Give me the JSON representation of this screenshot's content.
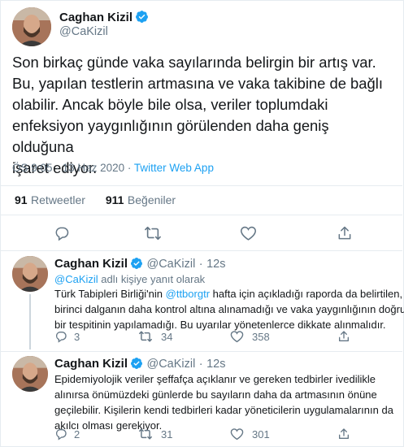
{
  "main_tweet": {
    "author_name": "Caghan Kizil",
    "author_handle": "@CaKizil",
    "lines": [
      "Son birkaç günde vaka sayılarında belirgin bir artış var.",
      "Bu, yapılan testlerin artmasına ve vaka takibine de bağlı",
      "olabilir. Ancak böyle bile olsa, veriler toplumdaki",
      "enfeksiyon yaygınlığının görülenden daha geniş olduğuna",
      "işaret ediyor."
    ],
    "time": "ÖS 9:05",
    "separator": "·",
    "date": "13 Haz 2020",
    "source": "Twitter Web App",
    "retweets": "91",
    "retweets_label": "Retweetler",
    "likes": "911",
    "likes_label": "Beğeniler"
  },
  "replies": [
    {
      "author_name": "Caghan Kizil",
      "author_handle": "@CaKizil",
      "separator": "·",
      "time": "12s",
      "reply_to_handle": "@CaKizil",
      "reply_to_text": "adlı kişiye yanıt olarak",
      "line1_a": "Türk Tabipleri Birliği'nin ",
      "line1_mention": "@ttborgtr",
      "line1_b": " hafta için açıkladığı raporda da belirtilen,",
      "line2": "birinci dalganın daha kontrol altına alınamadığı ve vaka yaygınlığının doğru",
      "line3": "bir tespitinin yapılamadığı. Bu uyarılar yönetenlerce dikkate alınmalıdır.",
      "replies": "3",
      "retweets": "34",
      "likes": "358"
    },
    {
      "author_name": "Caghan Kizil",
      "author_handle": "@CaKizil",
      "separator": "·",
      "time": "12s",
      "line1": "Epidemiyolojik veriler şeffafça açıklanır ve gereken tedbirler ivedilikle",
      "line2": "alınırsa önümüzdeki günlerde bu sayıların daha da artmasının önüne",
      "line3": "geçilebilir. Kişilerin kendi tedbirleri kadar yöneticilerin uygulamalarının da",
      "line4": "akılcı olması gerekiyor.",
      "replies": "2",
      "retweets": "31",
      "likes": "301"
    }
  ],
  "icons": {
    "reply": "reply-icon",
    "retweet": "retweet-icon",
    "like": "heart-icon",
    "share": "share-icon",
    "verified": "verified-badge-icon"
  },
  "colors": {
    "accent": "#1da1f2",
    "text": "#14171a",
    "secondary": "#657786",
    "border": "#e6ecf0"
  }
}
